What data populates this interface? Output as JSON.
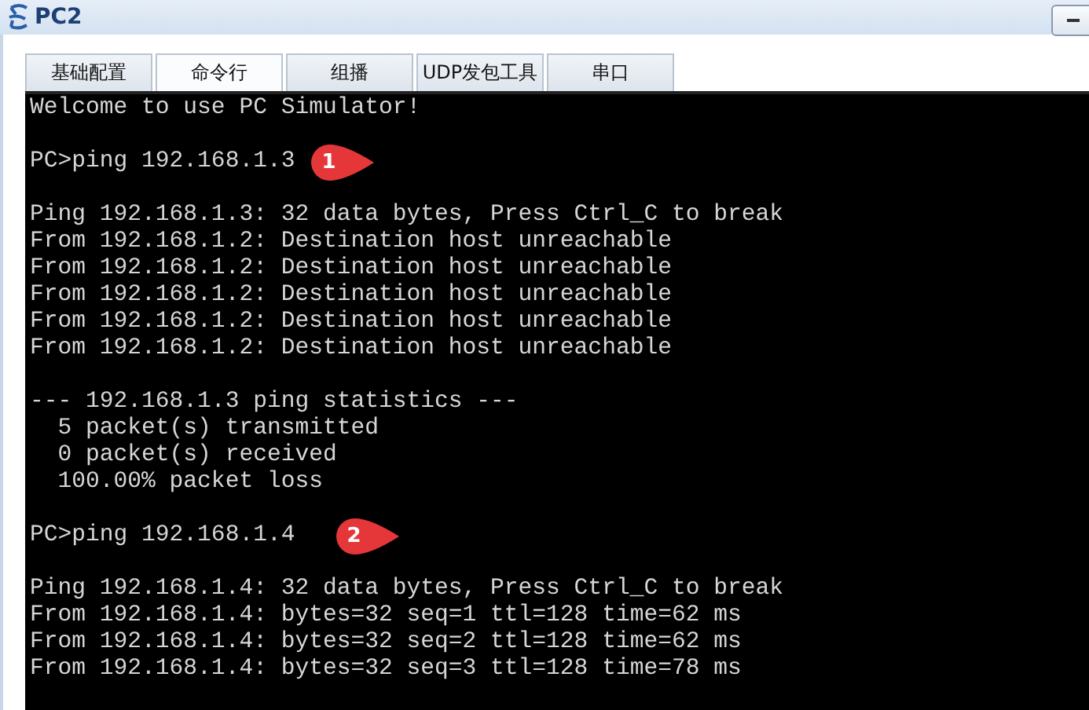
{
  "window": {
    "title": "PC2"
  },
  "tabs": [
    {
      "label": "基础配置",
      "selected": false
    },
    {
      "label": "命令行",
      "selected": true
    },
    {
      "label": "组播",
      "selected": false
    },
    {
      "label": "UDP发包工具",
      "selected": false
    },
    {
      "label": "串口",
      "selected": false
    }
  ],
  "terminal": {
    "blocks": [
      [
        {
          "text": "Welcome to use PC Simulator!"
        }
      ],
      [
        {
          "text": "PC>ping 192.168.1.3",
          "callout": "1"
        }
      ],
      [
        {
          "text": "Ping 192.168.1.3: 32 data bytes, Press Ctrl_C to break"
        },
        {
          "text": "From 192.168.1.2: Destination host unreachable"
        },
        {
          "text": "From 192.168.1.2: Destination host unreachable"
        },
        {
          "text": "From 192.168.1.2: Destination host unreachable"
        },
        {
          "text": "From 192.168.1.2: Destination host unreachable"
        },
        {
          "text": "From 192.168.1.2: Destination host unreachable"
        }
      ],
      [
        {
          "text": "--- 192.168.1.3 ping statistics ---"
        },
        {
          "text": "  5 packet(s) transmitted"
        },
        {
          "text": "  0 packet(s) received"
        },
        {
          "text": "  100.00% packet loss"
        }
      ],
      [
        {
          "text": "PC>ping 192.168.1.4",
          "callout": "2"
        }
      ],
      [
        {
          "text": "Ping 192.168.1.4: 32 data bytes, Press Ctrl_C to break"
        },
        {
          "text": "From 192.168.1.4: bytes=32 seq=1 ttl=128 time=62 ms"
        },
        {
          "text": "From 192.168.1.4: bytes=32 seq=2 ttl=128 time=62 ms"
        },
        {
          "text": "From 192.168.1.4: bytes=32 seq=3 ttl=128 time=78 ms"
        }
      ]
    ]
  }
}
